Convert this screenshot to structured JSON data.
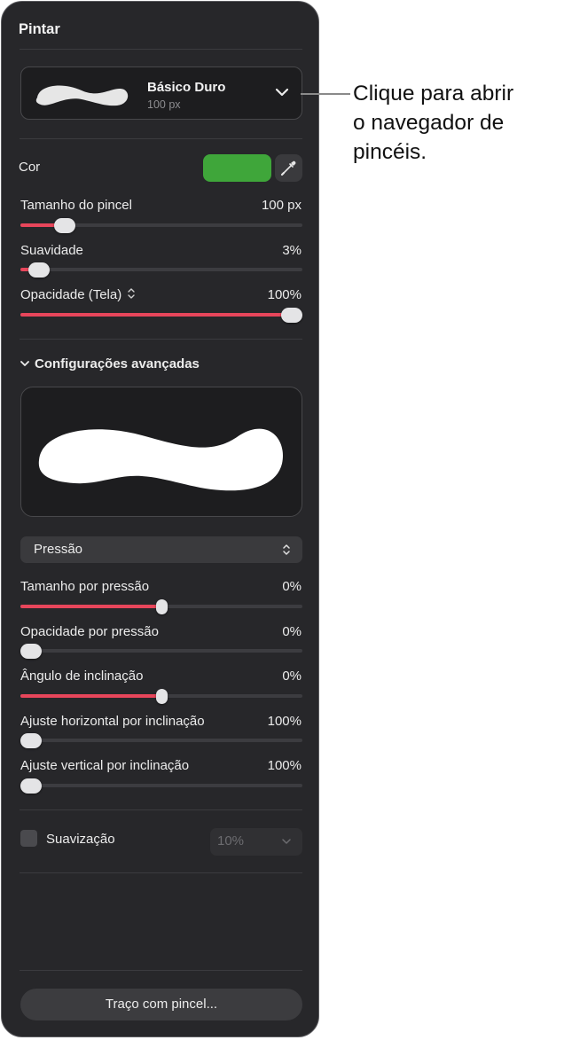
{
  "panel": {
    "title": "Pintar"
  },
  "brush": {
    "name": "Básico Duro",
    "size": "100 px"
  },
  "color": {
    "label": "Cor",
    "swatch": "#3fa63a"
  },
  "sliders_basic": [
    {
      "label": "Tamanho do pincel",
      "value": "100 px",
      "level": 0.13
    },
    {
      "label": "Suavidade",
      "value": "3%",
      "level": 0.03
    },
    {
      "label": "Opacidade (Tela)",
      "value": "100%",
      "level": 1.0
    }
  ],
  "advanced": {
    "title": "Configurações avançadas",
    "input_mode": "Pressão",
    "sliders": [
      {
        "label": "Tamanho por pressão",
        "value": "0%",
        "level": 0.5
      },
      {
        "label": "Opacidade por pressão",
        "value": "0%",
        "level": 0.0
      },
      {
        "label": "Ângulo de inclinação",
        "value": "0%",
        "level": 0.5
      },
      {
        "label": "Ajuste horizontal por inclinação",
        "value": "100%",
        "level": 0.0
      },
      {
        "label": "Ajuste vertical por inclinação",
        "value": "100%",
        "level": 0.0
      }
    ]
  },
  "smoothing": {
    "label": "Suavização",
    "value": "10%",
    "checked": false
  },
  "stroke_button": "Traço com pincel...",
  "callout": {
    "line1": "Clique para abrir",
    "line2": "o navegador de",
    "line3": "pincéis."
  }
}
